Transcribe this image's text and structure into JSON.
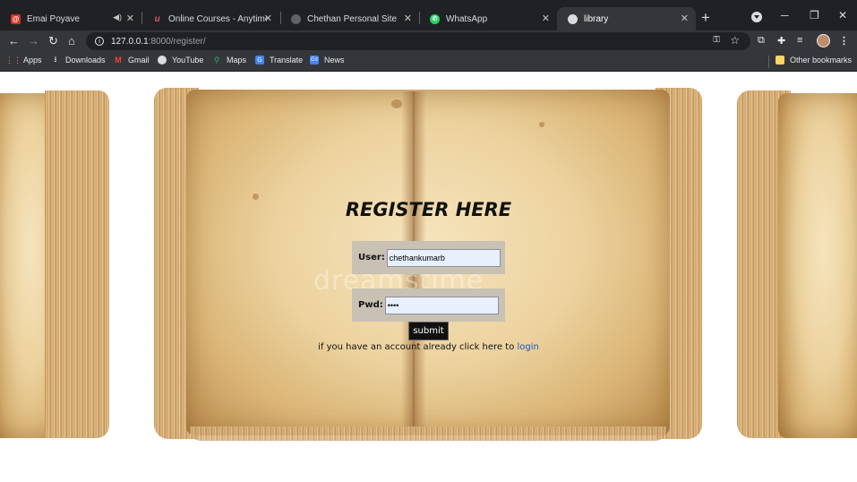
{
  "browser": {
    "tabs": [
      {
        "title": "Emai Poyave",
        "favicon_color": "#d93025",
        "favicon_glyph": "@",
        "has_sound": true
      },
      {
        "title": "Online Courses - Anytime, An",
        "favicon_color": "#a51c30",
        "favicon_glyph": "u"
      },
      {
        "title": "Chethan Personal Site",
        "favicon_color": "#5f6368",
        "favicon_glyph": "●"
      },
      {
        "title": "WhatsApp",
        "favicon_color": "#25d366",
        "favicon_glyph": "✆"
      },
      {
        "title": "library",
        "favicon_color": "#9aa0a6",
        "favicon_glyph": "🌐",
        "active": true
      }
    ],
    "address": {
      "host": "127.0.0.1",
      "path": ":8000/register/"
    },
    "bookmarks": [
      {
        "label": "Apps",
        "icon": "apps-grid-icon"
      },
      {
        "label": "Downloads",
        "icon": "download-icon"
      },
      {
        "label": "Gmail",
        "icon": "gmail-icon"
      },
      {
        "label": "YouTube",
        "icon": "globe-icon"
      },
      {
        "label": "Maps",
        "icon": "maps-pin-icon"
      },
      {
        "label": "Translate",
        "icon": "translate-icon"
      },
      {
        "label": "News",
        "icon": "news-icon"
      }
    ],
    "other_bookmarks": "Other bookmarks"
  },
  "page": {
    "heading": "REGISTER HERE",
    "user_label": "User:",
    "user_value": "chethankumarb",
    "pwd_label": "Pwd:",
    "pwd_value": "••••",
    "submit_label": "submit",
    "hint_text": "if you have an account already click here to ",
    "login_link": "login",
    "watermark": "dreamstime"
  },
  "colors": {
    "chrome_dark": "#202124",
    "chrome_toolbar": "#35363a",
    "link": "#1a55c5",
    "field_bg": "#c8c1b4",
    "autofill": "#e8f0fe"
  }
}
